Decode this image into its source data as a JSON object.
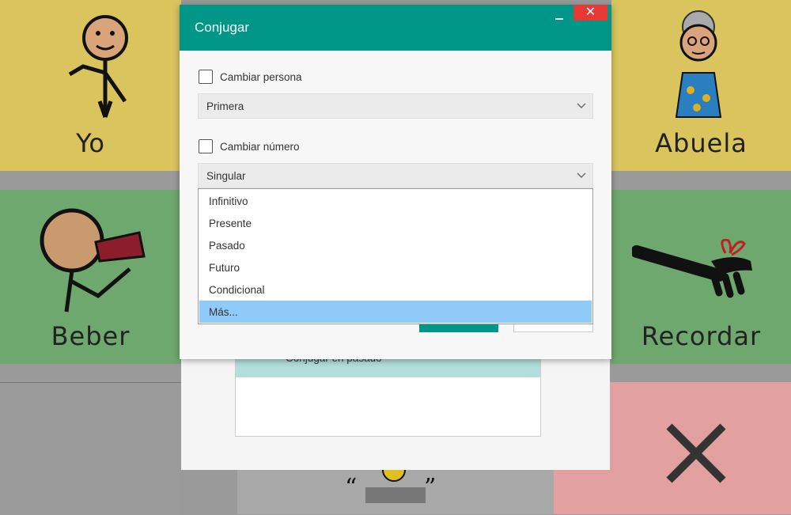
{
  "tiles": {
    "yo": "Yo",
    "abuela": "Abuela",
    "beber": "Beber",
    "recordar": "Recordar"
  },
  "dialog": {
    "title": "Conjugar",
    "close_symbol": "✕",
    "change_person_label": "Cambiar persona",
    "person_value": "Primera",
    "change_number_label": "Cambiar número",
    "number_value": "Singular"
  },
  "dropdown": {
    "options": [
      "Infinitivo",
      "Presente",
      "Pasado",
      "Futuro",
      "Condicional",
      "Más..."
    ],
    "selected_index": 5
  },
  "background_list": {
    "item_label": "Conjugar en pasado"
  },
  "colors": {
    "accent": "#009688",
    "close": "#e53935",
    "highlight": "#90caf9",
    "tile_yellow": "#e3cf66",
    "tile_green": "#7bb77a",
    "tile_red": "#e3a2a2"
  }
}
